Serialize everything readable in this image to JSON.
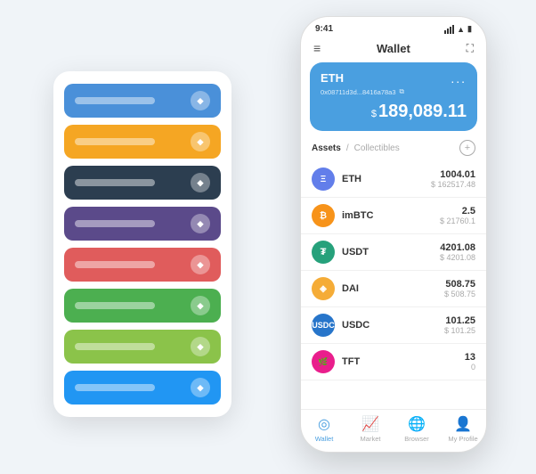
{
  "background": "#f0f4f8",
  "left_panel": {
    "cards": [
      {
        "color": "card-blue",
        "label": "",
        "symbol": "◆"
      },
      {
        "color": "card-orange",
        "label": "",
        "symbol": "◆"
      },
      {
        "color": "card-dark",
        "label": "",
        "symbol": "◆"
      },
      {
        "color": "card-purple",
        "label": "",
        "symbol": "◆"
      },
      {
        "color": "card-red",
        "label": "",
        "symbol": "◆"
      },
      {
        "color": "card-green",
        "label": "",
        "symbol": "◆"
      },
      {
        "color": "card-lime",
        "label": "",
        "symbol": "◆"
      },
      {
        "color": "card-blue2",
        "label": "",
        "symbol": "◆"
      }
    ]
  },
  "phone": {
    "status_bar": {
      "time": "9:41",
      "signal": "●●●",
      "wifi": "WiFi",
      "battery": "🔋"
    },
    "header": {
      "menu_icon": "≡",
      "title": "Wallet",
      "expand_icon": "⛶"
    },
    "wallet_card": {
      "currency": "ETH",
      "dots": "...",
      "address": "0x08711d3d...8416a78a3",
      "copy_icon": "⧉",
      "dollar_sign": "$",
      "balance": "189,089.11"
    },
    "assets_header": {
      "tab_active": "Assets",
      "separator": "/",
      "tab_inactive": "Collectibles",
      "add_icon": "+"
    },
    "assets": [
      {
        "symbol": "ETH",
        "icon_label": "Ξ",
        "icon_class": "asset-icon-eth",
        "amount": "1004.01",
        "usd": "$ 162517.48"
      },
      {
        "symbol": "imBTC",
        "icon_label": "₿",
        "icon_class": "asset-icon-imbtc",
        "amount": "2.5",
        "usd": "$ 21760.1"
      },
      {
        "symbol": "USDT",
        "icon_label": "T",
        "icon_class": "asset-icon-usdt",
        "amount": "4201.08",
        "usd": "$ 4201.08"
      },
      {
        "symbol": "DAI",
        "icon_label": "◈",
        "icon_class": "asset-icon-dai",
        "amount": "508.75",
        "usd": "$ 508.75"
      },
      {
        "symbol": "USDC",
        "icon_label": "$",
        "icon_class": "asset-icon-usdc",
        "amount": "101.25",
        "usd": "$ 101.25"
      },
      {
        "symbol": "TFT",
        "icon_label": "T",
        "icon_class": "asset-icon-tft",
        "amount": "13",
        "usd": "0"
      }
    ],
    "bottom_nav": [
      {
        "icon": "◎",
        "label": "Wallet",
        "active": true
      },
      {
        "icon": "📈",
        "label": "Market",
        "active": false
      },
      {
        "icon": "🌐",
        "label": "Browser",
        "active": false
      },
      {
        "icon": "👤",
        "label": "My Profile",
        "active": false
      }
    ]
  }
}
